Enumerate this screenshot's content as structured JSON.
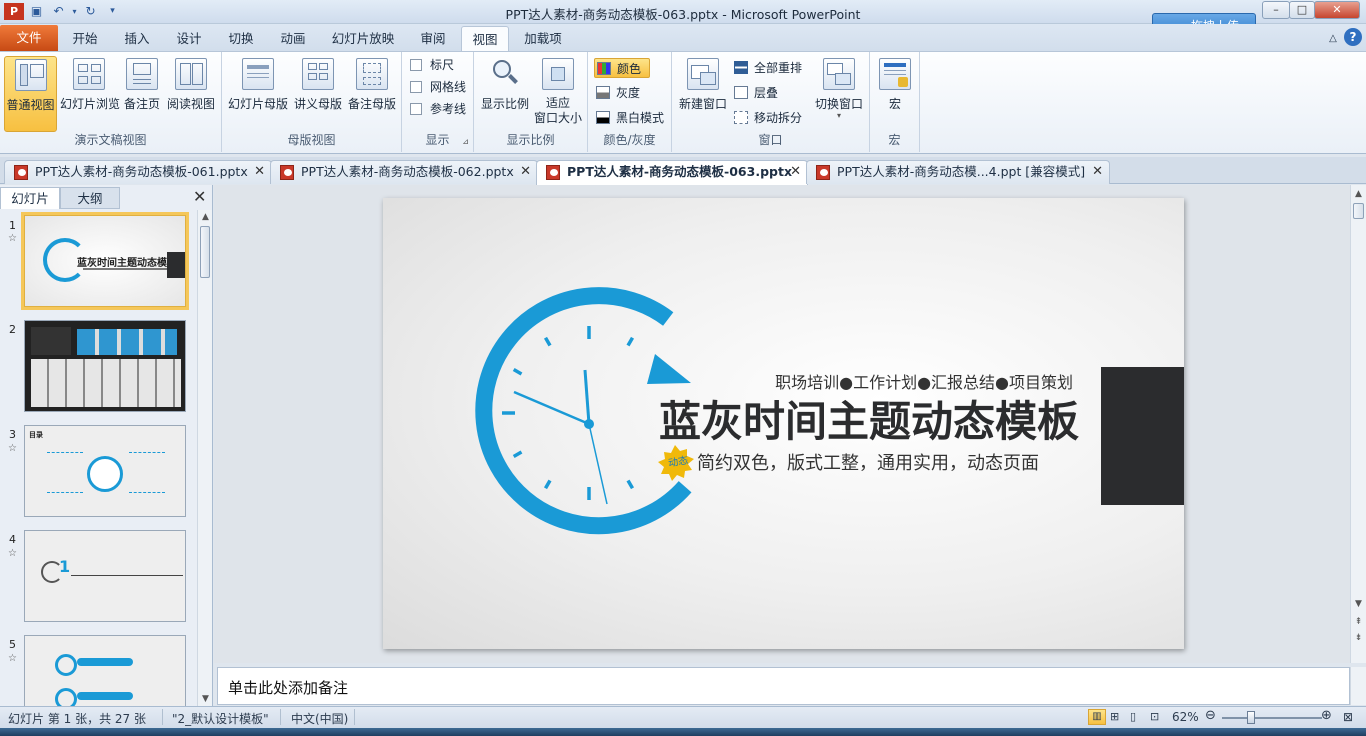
{
  "window": {
    "title": "PPT达人素材-商务动态模板-063.pptx - Microsoft PowerPoint",
    "upload_label": "拖拽上传"
  },
  "ribbon_tabs": [
    "文件",
    "开始",
    "插入",
    "设计",
    "切换",
    "动画",
    "幻灯片放映",
    "审阅",
    "视图",
    "加载项"
  ],
  "ribbon": {
    "presentation_views": {
      "label": "演示文稿视图",
      "buttons": [
        "普通视图",
        "幻灯片浏览",
        "备注页",
        "阅读视图"
      ]
    },
    "master_views": {
      "label": "母版视图",
      "buttons": [
        "幻灯片母版",
        "讲义母版",
        "备注母版"
      ]
    },
    "show": {
      "label": "显示",
      "items": [
        "标尺",
        "网格线",
        "参考线"
      ]
    },
    "zoom": {
      "label": "显示比例",
      "zoom_button": "显示比例",
      "fit_button_line1": "适应",
      "fit_button_line2": "窗口大小"
    },
    "color": {
      "label": "颜色/灰度",
      "items": [
        "颜色",
        "灰度",
        "黑白模式"
      ]
    },
    "window": {
      "label": "窗口",
      "new_window": "新建窗口",
      "items": [
        "全部重排",
        "层叠",
        "移动拆分"
      ],
      "switch": "切换窗口"
    },
    "macro": {
      "label": "宏",
      "button": "宏"
    }
  },
  "doc_tabs": [
    {
      "title": "PPT达人素材-商务动态模板-061.pptx",
      "active": false
    },
    {
      "title": "PPT达人素材-商务动态模板-062.pptx",
      "active": false
    },
    {
      "title": "PPT达人素材-商务动态模板-063.pptx",
      "active": true
    },
    {
      "title": "PPT达人素材-商务动态模...4.ppt [兼容模式]",
      "active": false
    }
  ],
  "left_pane": {
    "tabs": [
      "幻灯片",
      "大纲"
    ],
    "slide_numbers": [
      "1",
      "2",
      "3",
      "4",
      "5"
    ],
    "thumb1_title": "蓝灰时间主题动态模板",
    "thumb3_heading": "目录",
    "thumb4_num": "1"
  },
  "slide": {
    "subtitle_line": "职场培训●工作计划●汇报总结●项目策划",
    "title": "蓝灰时间主题动态模板",
    "badge": "动态",
    "tagline": "简约双色，版式工整，通用实用，动态页面"
  },
  "notes_placeholder": "单击此处添加备注",
  "status": {
    "slide_info": "幻灯片 第 1 张，共 27 张",
    "theme": "\"2_默认设计模板\"",
    "language": "中文(中国)",
    "zoom": "62%"
  },
  "colors": {
    "accent_blue": "#1a9ad6",
    "dark_block": "#2b2c2e",
    "file_tab": "#d95a1e"
  },
  "icons": [
    "save-icon",
    "undo-icon",
    "redo-icon",
    "minimize-icon",
    "maximize-icon",
    "close-icon",
    "cloud-upload-icon",
    "help-icon"
  ]
}
